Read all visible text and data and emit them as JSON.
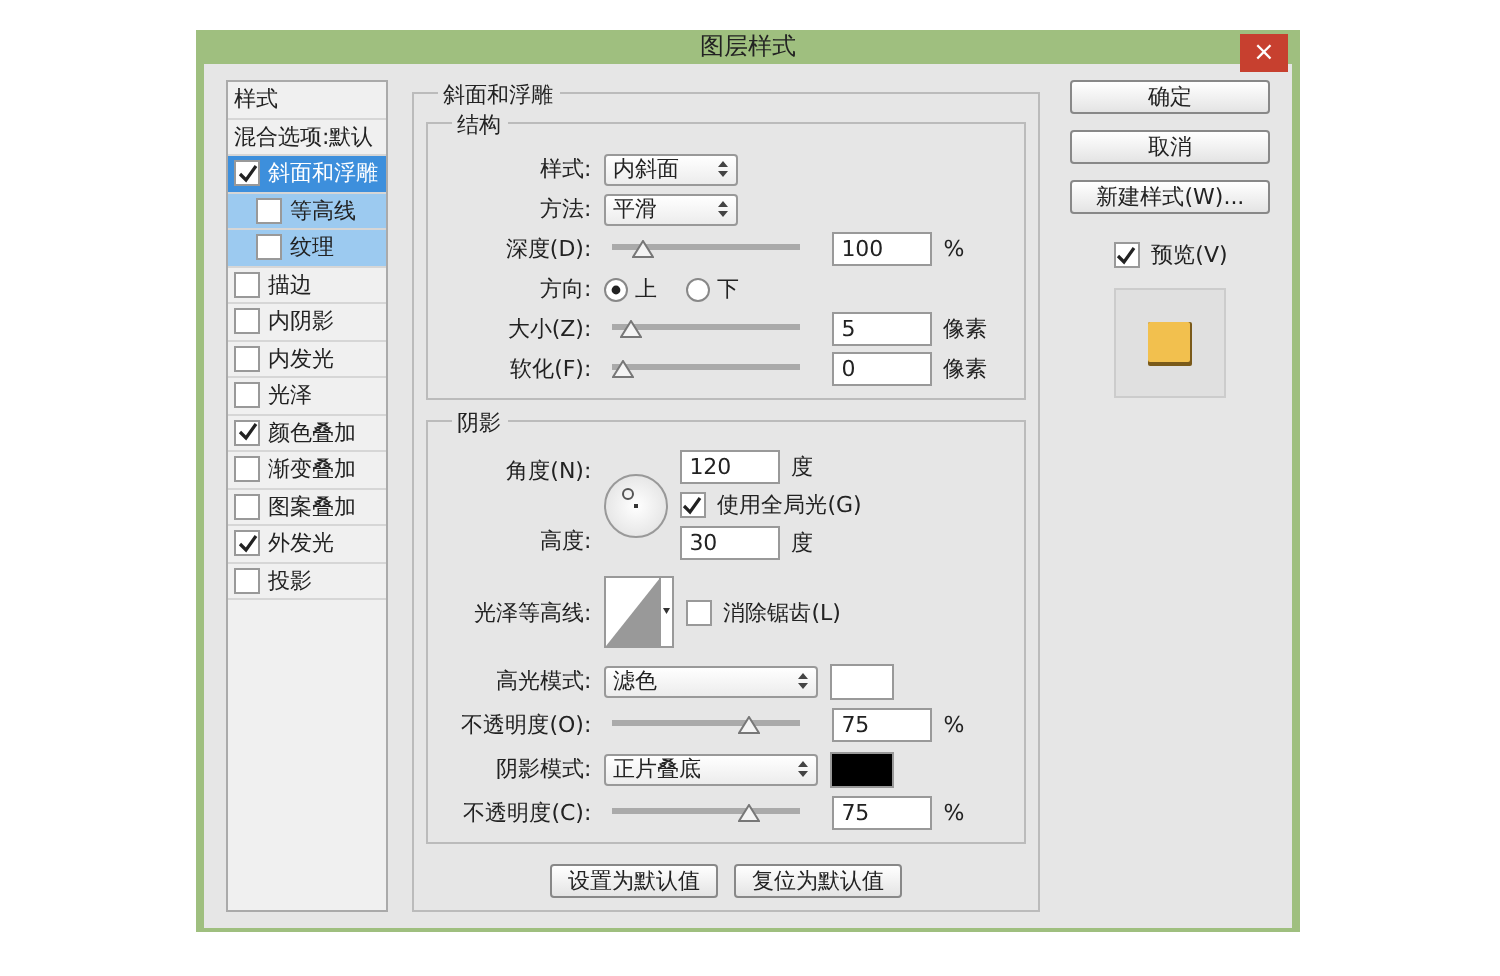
{
  "window": {
    "title": "图层样式",
    "close": "×"
  },
  "styles": [
    {
      "kind": "header",
      "label": "样式"
    },
    {
      "kind": "plain",
      "label": "混合选项:默认",
      "selected": false
    },
    {
      "kind": "effect",
      "label": "斜面和浮雕",
      "checked": true,
      "selected": true,
      "children": [
        {
          "kind": "effect",
          "label": "等高线",
          "checked": false,
          "selected": false
        },
        {
          "kind": "effect",
          "label": "纹理",
          "checked": false,
          "selected": false
        }
      ]
    },
    {
      "kind": "effect",
      "label": "描边",
      "checked": false,
      "selected": false
    },
    {
      "kind": "effect",
      "label": "内阴影",
      "checked": false,
      "selected": false
    },
    {
      "kind": "effect",
      "label": "内发光",
      "checked": false,
      "selected": false
    },
    {
      "kind": "effect",
      "label": "光泽",
      "checked": false,
      "selected": false
    },
    {
      "kind": "effect",
      "label": "颜色叠加",
      "checked": true,
      "selected": false
    },
    {
      "kind": "effect",
      "label": "渐变叠加",
      "checked": false,
      "selected": false
    },
    {
      "kind": "effect",
      "label": "图案叠加",
      "checked": false,
      "selected": false
    },
    {
      "kind": "effect",
      "label": "外发光",
      "checked": true,
      "selected": false
    },
    {
      "kind": "effect",
      "label": "投影",
      "checked": false,
      "selected": false
    }
  ],
  "panel": {
    "title": "斜面和浮雕",
    "structure": {
      "title": "结构",
      "rows": [
        {
          "kind": "select",
          "label": "样式:",
          "value": "内斜面"
        },
        {
          "kind": "select",
          "label": "方法:",
          "value": "平滑"
        },
        {
          "kind": "slider",
          "label": "深度(D):",
          "level": 0.12,
          "value": "100",
          "unit": "%"
        },
        {
          "kind": "radio",
          "label": "方向:",
          "options": [
            {
              "label": "上",
              "selected": true
            },
            {
              "label": "下",
              "selected": false
            }
          ]
        },
        {
          "kind": "slider",
          "label": "大小(Z):",
          "level": 0.05,
          "value": "5",
          "unit": "像素"
        },
        {
          "kind": "slider",
          "label": "软化(F):",
          "level": 0,
          "value": "0",
          "unit": "像素"
        }
      ]
    },
    "shading": {
      "title": "阴影",
      "angle_label": "角度(N):",
      "angle": "120",
      "angle_unit": "度",
      "global_light": {
        "label": "使用全局光(G)",
        "checked": true
      },
      "altitude_label": "高度:",
      "altitude": "30",
      "altitude_unit": "度",
      "contour_label": "光泽等高线:",
      "anti_alias": {
        "label": "消除锯齿(L)",
        "checked": false
      },
      "rows": [
        {
          "kind": "select",
          "label": "高光模式:",
          "value": "滤色",
          "color": "#ffffff"
        },
        {
          "kind": "slider",
          "label": "不透明度(O):",
          "level": 0.75,
          "value": "75",
          "unit": "%"
        },
        {
          "kind": "select",
          "label": "阴影模式:",
          "value": "正片叠底",
          "color": "#000000"
        },
        {
          "kind": "slider",
          "label": "不透明度(C):",
          "level": 0.75,
          "value": "75",
          "unit": "%"
        }
      ]
    },
    "buttons": [
      "设置为默认值",
      "复位为默认值"
    ]
  },
  "actions": [
    "确定",
    "取消",
    "新建样式(W)..."
  ],
  "preview": {
    "label": "预览(V)",
    "checked": true
  }
}
